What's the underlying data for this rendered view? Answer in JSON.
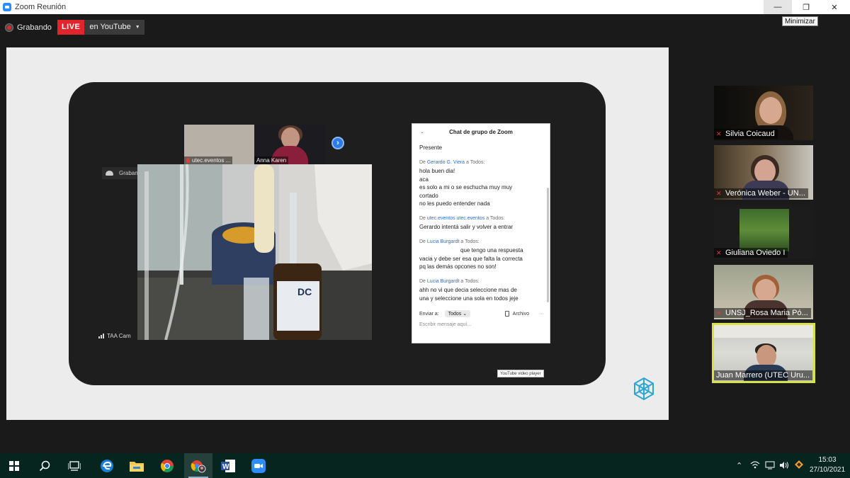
{
  "window": {
    "title": "Zoom Reunión",
    "minimize_symbol": "—",
    "restore_symbol": "❐",
    "close_symbol": "✕",
    "tooltip": "Minimizar"
  },
  "recording": {
    "label": "Grabando",
    "live_badge": "LIVE",
    "destination": "en YouTube",
    "dropdown_symbol": "▼"
  },
  "shared_screen": {
    "thumbnails": [
      {
        "name": "utec.eventos ..."
      },
      {
        "name": "Anna Karen"
      }
    ],
    "next_symbol": "›",
    "mini_recording_label": "Grabando...",
    "camera_label": "TAA Cam",
    "chat": {
      "title": "Chat de grupo de Zoom",
      "collapse_symbol": "⌄",
      "first_line": "Presente",
      "messages": [
        {
          "prefix": "De",
          "sender": "Gerardo G. Viera",
          "target": "a Todos:",
          "lines": [
            "hola buen dia!",
            "aca",
            "es solo a mi o se eschucha muy muy",
            "cortado",
            "no les puedo entender nada"
          ]
        },
        {
          "prefix": "De",
          "sender": "utec.eventos utec.eventos",
          "target": "a Todos:",
          "lines": [
            "Gerardo intentá salir y volver a entrar"
          ]
        },
        {
          "prefix": "De",
          "sender": "Lucia Burgardt",
          "target": "a Todos:",
          "lines": [
            "que tengo una respuesta",
            "vacia y debe ser esa que falta la correcta",
            "pq las demás opcones no son!"
          ]
        },
        {
          "prefix": "De",
          "sender": "Lucia Burgardt",
          "target": "a Todos:",
          "lines": [
            "ahh no vi que decia seleccione mas de",
            "una y seleccione una sola en todos jeje"
          ]
        }
      ],
      "send_to_label": "Enviar a:",
      "send_to_value": "Todos",
      "send_to_caret": "⌄",
      "file_label": "Archivo",
      "more_symbol": "···",
      "input_placeholder": "Escribir mensaje aquí..."
    },
    "youtube_tooltip": "YouTube video player"
  },
  "gallery": [
    {
      "name": "Silvia Coicaud",
      "muted": true,
      "active": false
    },
    {
      "name": "Verónica Weber - UN...",
      "muted": true,
      "active": false
    },
    {
      "name": "Giuliana Oviedo I",
      "muted": true,
      "active": false
    },
    {
      "name": "UNSJ_Rosa Maria Pó...",
      "muted": true,
      "active": false
    },
    {
      "name": "Juan Marrero (UTEC Uru...",
      "muted": false,
      "active": true
    }
  ],
  "taskbar": {
    "apps": [
      "windows-start",
      "search",
      "task-view",
      "edge",
      "file-explorer",
      "chrome",
      "chrome-profile",
      "word",
      "zoom"
    ],
    "tray": {
      "caret_symbol": "⌃",
      "time": "15:03",
      "date": "27/10/2021"
    }
  },
  "colors": {
    "live_red": "#e0262c",
    "zoom_blue": "#2d8cff",
    "active_speaker_border": "#d7e14a",
    "chat_sender_blue": "#2b6fd6",
    "taskbar_bg": "#07251f"
  }
}
